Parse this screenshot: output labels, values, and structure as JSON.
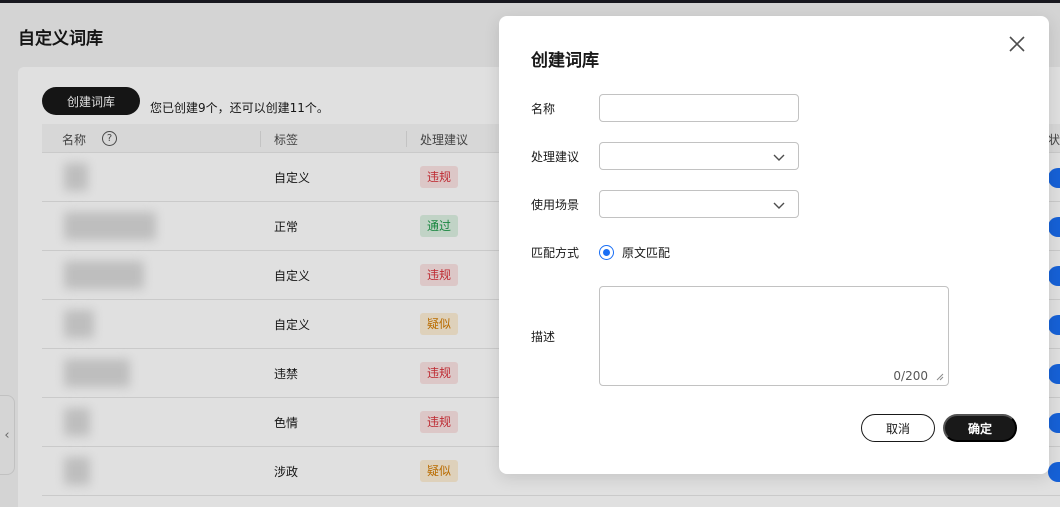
{
  "page": {
    "title": "自定义词库",
    "create_button": "创建词库",
    "quota_text": "您已创建9个，还可以创建11个。"
  },
  "table": {
    "columns": [
      "名称",
      "标签",
      "处理建议",
      "状"
    ],
    "rows": [
      {
        "label": "自定义",
        "suggestion": "违规",
        "suggestion_type": "violation"
      },
      {
        "label": "正常",
        "suggestion": "通过",
        "suggestion_type": "pass"
      },
      {
        "label": "自定义",
        "suggestion": "违规",
        "suggestion_type": "violation"
      },
      {
        "label": "自定义",
        "suggestion": "疑似",
        "suggestion_type": "suspect"
      },
      {
        "label": "违禁",
        "suggestion": "违规",
        "suggestion_type": "violation"
      },
      {
        "label": "色情",
        "suggestion": "违规",
        "suggestion_type": "violation"
      },
      {
        "label": "涉政",
        "suggestion": "疑似",
        "suggestion_type": "suspect"
      }
    ]
  },
  "modal": {
    "title": "创建词库",
    "fields": {
      "name_label": "名称",
      "name_value": "",
      "suggestion_label": "处理建议",
      "suggestion_value": "",
      "scene_label": "使用场景",
      "scene_value": "",
      "match_label": "匹配方式",
      "match_option": "原文匹配",
      "desc_label": "描述",
      "desc_value": "",
      "desc_counter": "0/200"
    },
    "cancel_label": "取消",
    "ok_label": "确定"
  },
  "colors": {
    "accent": "#1a6ff5",
    "primary_button": "#191919",
    "violation": "#d9313a",
    "pass": "#1f9a4a",
    "suspect": "#d37b00"
  },
  "icons": [
    "help-icon",
    "close-icon",
    "chevron-down-icon",
    "chevron-left-icon",
    "resize-handle-icon"
  ]
}
